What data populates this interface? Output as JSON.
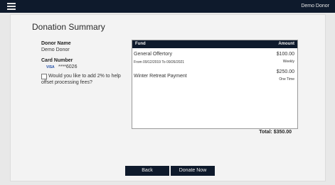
{
  "topbar": {
    "menu_icon": "hamburger-menu-icon",
    "user_name": "Demo Donor"
  },
  "page": {
    "title": "Donation Summary"
  },
  "donor": {
    "name_label": "Donor Name",
    "name_value": "Demo Donor",
    "card_label": "Card Number",
    "card_brand": "VISA",
    "card_masked": "****6026"
  },
  "fees": {
    "checkbox_checked": false,
    "label": "Would you like to add 2% to help offset processing fees?"
  },
  "fund_table": {
    "header_fund": "Fund",
    "header_amount": "Amount",
    "rows": [
      {
        "fund": "General Offertory",
        "detail": "From 09/12/2019 To 09/26/2021",
        "amount": "$100.00",
        "frequency": "Weekly"
      },
      {
        "fund": "Winter Retreat Payment",
        "detail": "",
        "amount": "$250.00",
        "frequency": "One Time"
      }
    ]
  },
  "total": {
    "label": "Total: $350.00"
  },
  "buttons": {
    "back": "Back",
    "donate": "Donate Now"
  },
  "colors": {
    "header_bg": "#0e1a2c",
    "panel_bg": "#f3f3f3",
    "card_brand": "#2350a8"
  }
}
